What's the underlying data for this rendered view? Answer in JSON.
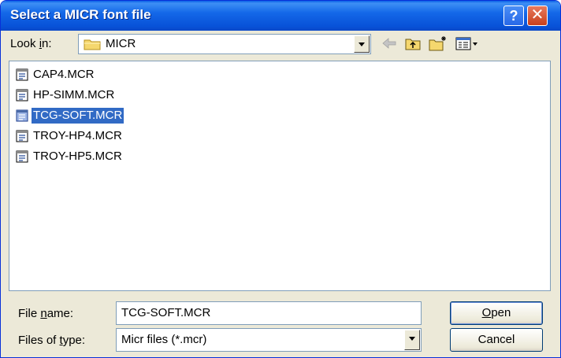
{
  "window": {
    "title": "Select a MICR font file",
    "help_glyph": "?",
    "close_glyph": "✕"
  },
  "toolbar": {
    "look_in_pre": "Look ",
    "look_in_key": "i",
    "look_in_post": "n:",
    "current_folder": "MICR",
    "icons": [
      "back-arrow-icon",
      "up-one-level-icon",
      "create-new-folder-icon",
      "view-menu-icon"
    ]
  },
  "files": [
    {
      "name": "CAP4.MCR",
      "selected": false
    },
    {
      "name": "HP-SIMM.MCR",
      "selected": false
    },
    {
      "name": "TCG-SOFT.MCR",
      "selected": true
    },
    {
      "name": "TROY-HP4.MCR",
      "selected": false
    },
    {
      "name": "TROY-HP5.MCR",
      "selected": false
    }
  ],
  "footer": {
    "file_name_pre": "File ",
    "file_name_key": "n",
    "file_name_post": "ame:",
    "file_name_value": "TCG-SOFT.MCR",
    "file_type_pre": "Files of ",
    "file_type_key": "t",
    "file_type_post": "ype:",
    "file_type_value": "Micr files (*.mcr)",
    "open_key": "O",
    "open_rest": "pen",
    "cancel_label": "Cancel"
  },
  "colors": {
    "title_bar": "#0a5fe6",
    "dialog_bg": "#ece9d8",
    "selection": "#316ac5",
    "field_border": "#7f9db9"
  }
}
